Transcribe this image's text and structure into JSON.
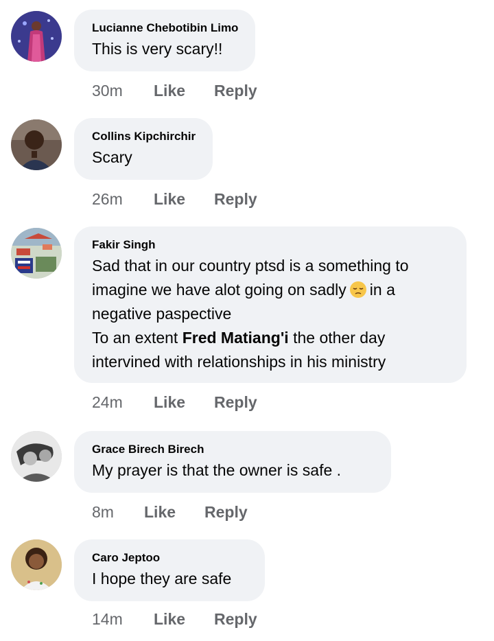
{
  "comments": [
    {
      "author": "Lucianne Chebotibin Limo",
      "text": "This is very scary!!",
      "time": "30m",
      "like_label": "Like",
      "reply_label": "Reply"
    },
    {
      "author": "Collins Kipchirchir",
      "text": "Scary",
      "time": "26m",
      "like_label": "Like",
      "reply_label": "Reply"
    },
    {
      "author": "Fakir Singh",
      "text_line1": "Sad that in our country ptsd is a something to",
      "text_line2a": "imagine we have alot going on sadly",
      "emoji": "pensive-face",
      "text_line2b": "in a",
      "text_line3": "negative paspective",
      "text_line4a": "To an extent",
      "mention": "Fred Matiang'i",
      "text_line4b": "the other day",
      "text_line5": "intervined with relationships in his ministry",
      "time": "24m",
      "like_label": "Like",
      "reply_label": "Reply"
    },
    {
      "author": "Grace Birech Birech",
      "text": "My prayer is that the owner is safe .",
      "time": "8m",
      "like_label": "Like",
      "reply_label": "Reply"
    },
    {
      "author": "Caro Jeptoo",
      "text": "I hope they are safe",
      "time": "14m",
      "like_label": "Like",
      "reply_label": "Reply"
    }
  ],
  "colors": {
    "bubble": "#f0f2f5",
    "meta_text": "#65676b",
    "text": "#050505"
  }
}
